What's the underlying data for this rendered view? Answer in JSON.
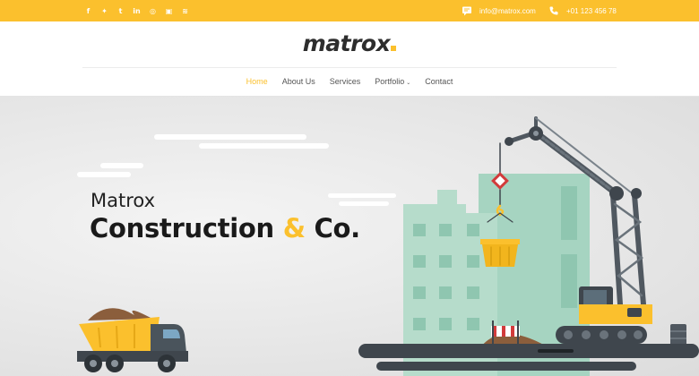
{
  "topbar": {
    "social_icons": [
      "facebook-icon",
      "twitter-icon",
      "tumblr-icon",
      "linkedin-icon",
      "dribbble-icon",
      "instagram-icon",
      "rss-icon"
    ],
    "email": "info@matrox.com",
    "phone": "+01 123 456 78"
  },
  "header": {
    "logo": "matrox"
  },
  "nav": {
    "items": [
      {
        "label": "Home",
        "active": true
      },
      {
        "label": "About Us",
        "active": false
      },
      {
        "label": "Services",
        "active": false
      },
      {
        "label": "Portfolio",
        "active": false
      },
      {
        "label": "Contact",
        "active": false
      }
    ]
  },
  "hero": {
    "line1": "Matrox",
    "line2_a": "Construction ",
    "line2_amp": "&",
    "line2_b": " Co."
  },
  "colors": {
    "accent": "#fbc02d",
    "text_dark": "#1a1a1a",
    "building": "#a6d4c1"
  }
}
